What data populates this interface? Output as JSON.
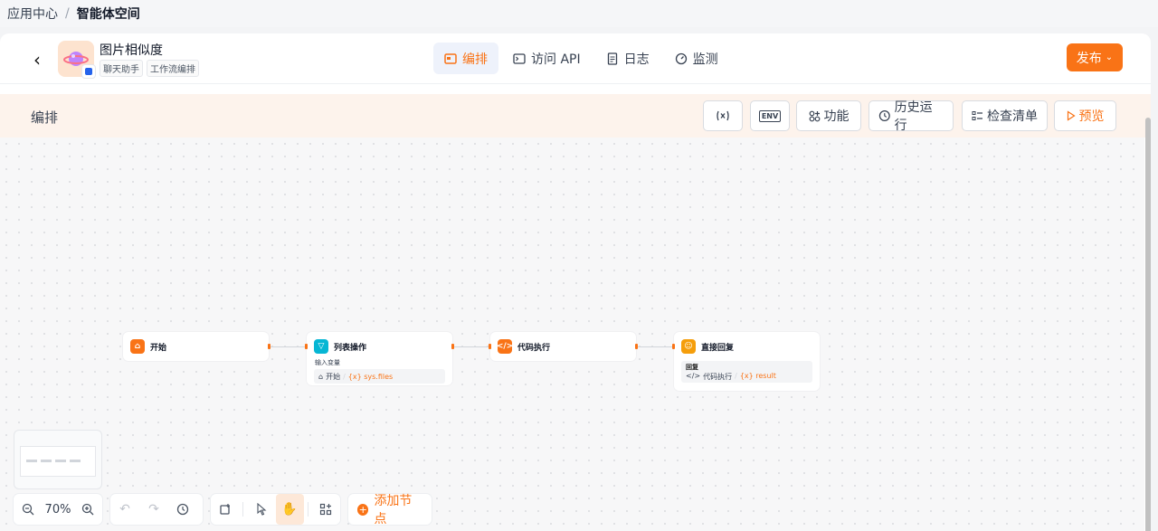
{
  "breadcrumb": {
    "parent": "应用中心",
    "separator": "/",
    "current": "智能体空间"
  },
  "app": {
    "name": "图片相似度",
    "tags": [
      "聊天助手",
      "工作流编排"
    ],
    "icon": "planet-emoji-icon"
  },
  "nav": {
    "tabs": [
      {
        "label": "编排",
        "icon": "layout-icon",
        "active": true
      },
      {
        "label": "访问 API",
        "icon": "terminal-icon",
        "active": false
      },
      {
        "label": "日志",
        "icon": "document-icon",
        "active": false
      },
      {
        "label": "监测",
        "icon": "gauge-icon",
        "active": false
      }
    ]
  },
  "publish": {
    "label": "发布"
  },
  "toolbar": {
    "title": "编排",
    "buttons": {
      "variables": "",
      "env": "ENV",
      "features": "功能",
      "history": "历史运行",
      "checklist": "检查清单",
      "preview": "预览"
    }
  },
  "nodes": [
    {
      "id": "start",
      "title": "开始",
      "icon": "home-icon",
      "color": "#f97316"
    },
    {
      "id": "list",
      "title": "列表操作",
      "icon": "filter-icon",
      "color": "#06b6d4",
      "sub_label": "输入变量",
      "var_source": "开始",
      "var_name": "{x} sys.files"
    },
    {
      "id": "code",
      "title": "代码执行",
      "icon": "code-icon",
      "color": "#f97316"
    },
    {
      "id": "reply",
      "title": "直接回复",
      "icon": "reply-icon",
      "color": "#f59e0b",
      "sub_label": "回复",
      "var_source": "代码执行",
      "var_name": "{x} result"
    }
  ],
  "controls": {
    "zoom": "70%",
    "add_node": "添加节点"
  },
  "colors": {
    "accent": "#f97316",
    "toolbar_bg": "#fdf3ec"
  }
}
